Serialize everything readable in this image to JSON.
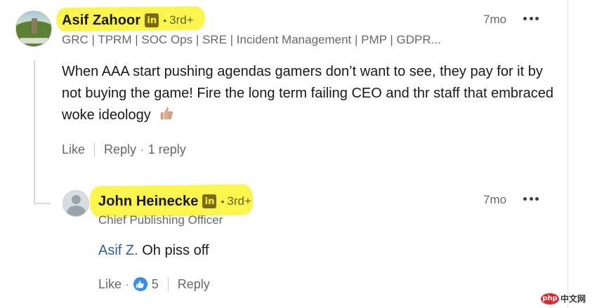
{
  "comment": {
    "author": {
      "name": "Asif Zahoor",
      "badge": "in",
      "degree": "3rd+",
      "headline": "GRC | TPRM | SOC Ops | SRE | Incident Management | PMP | GDPR..."
    },
    "time": "7mo",
    "text": "When AAA start pushing agendas gamers don’t want to see, they pay for it by not buying the game! Fire the long term failing CEO and thr staff that embraced woke ideology",
    "emoji_icon": "thumbs-up-emoji",
    "actions": {
      "like": "Like",
      "reply": "Reply",
      "reply_count": "1 reply"
    }
  },
  "reply": {
    "author": {
      "name": "John Heinecke",
      "badge": "in",
      "degree": "3rd+",
      "headline": "Chief Publishing Officer"
    },
    "time": "7mo",
    "mention": "Asif Z.",
    "text": "Oh piss off",
    "actions": {
      "like": "Like",
      "reaction_icon": "like-reaction-icon",
      "like_count": "5",
      "reply": "Reply"
    }
  },
  "watermark": {
    "badge": "php",
    "text": "中文网"
  },
  "colors": {
    "highlight": "#fbf43e",
    "mention": "#2f5f9e",
    "like_reaction": "#378fe9",
    "secondary_text": "#666666"
  },
  "symbols": {
    "dot": "•",
    "mid_dot": "·"
  }
}
